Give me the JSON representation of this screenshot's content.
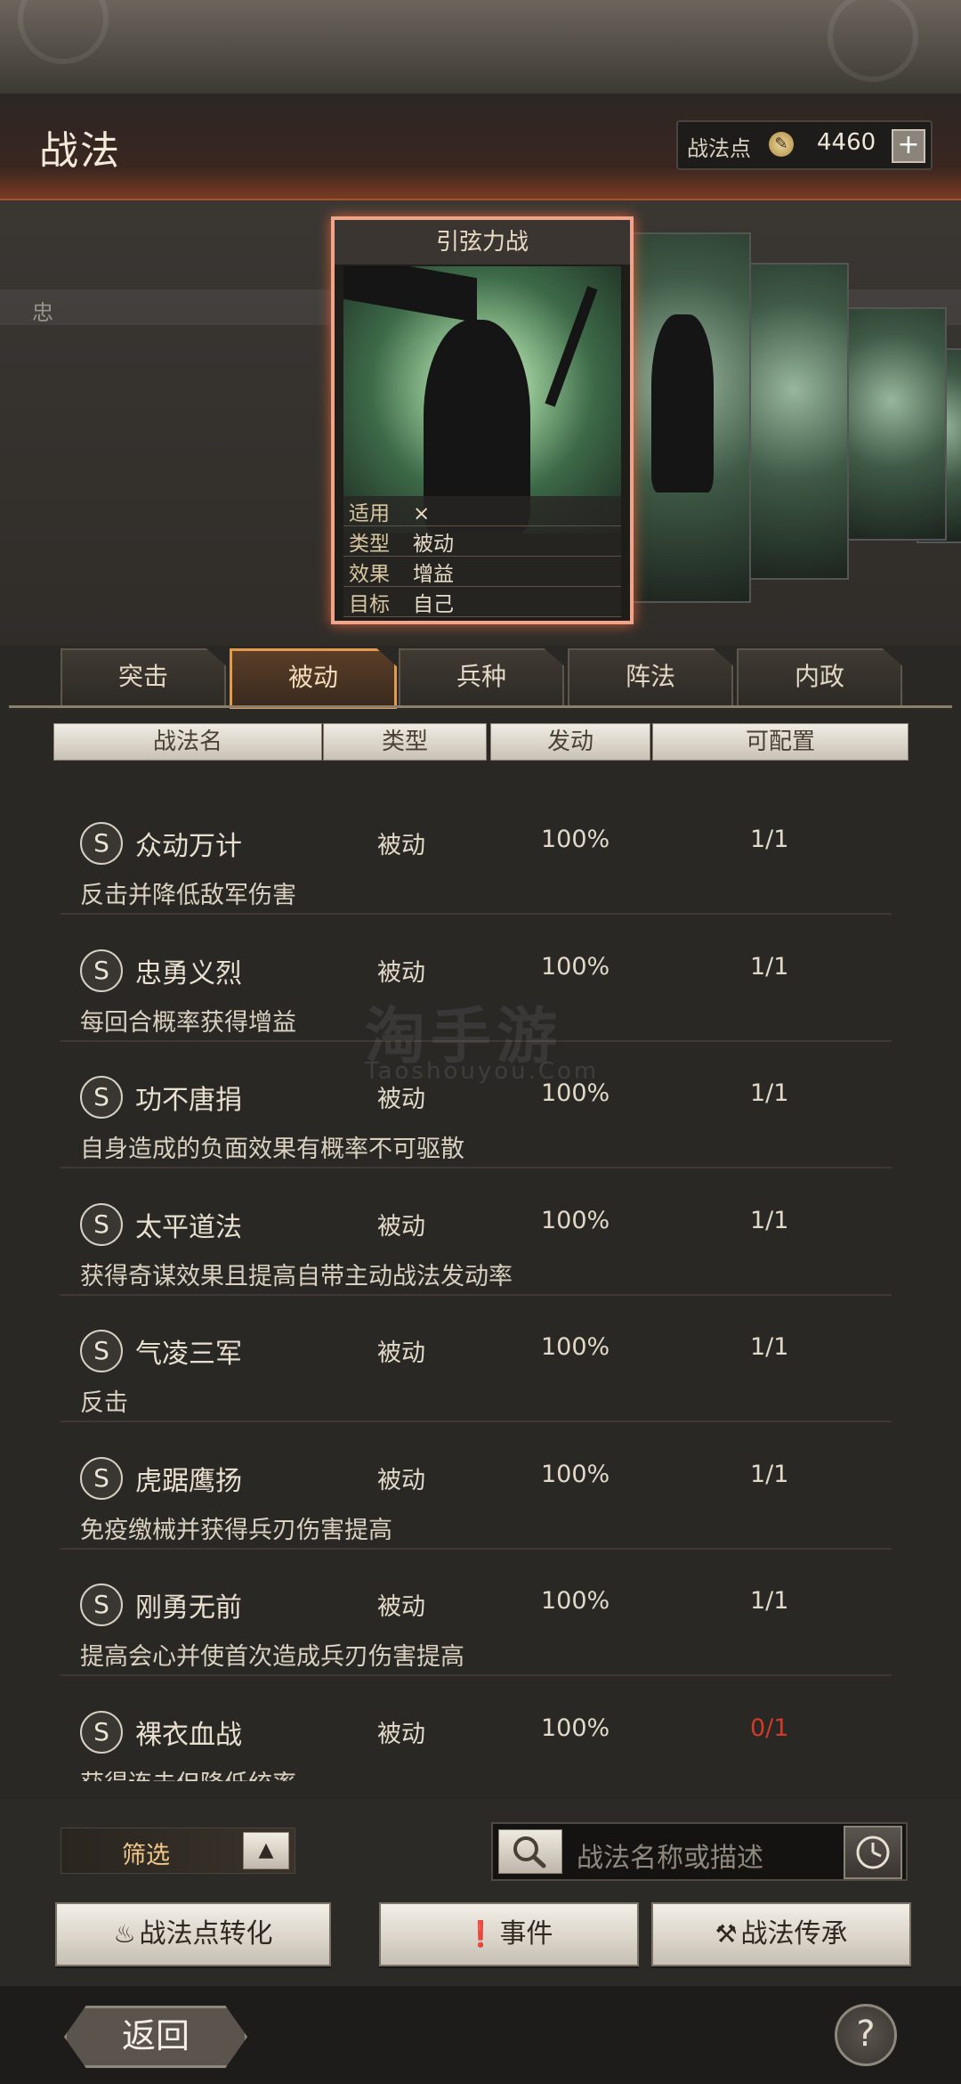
{
  "header": {
    "title": "战法",
    "points_label": "战法点",
    "points_value": "4460",
    "add_symbol": "+"
  },
  "band_char": "忠",
  "featured_card": {
    "name": "引弦力战",
    "attrs": [
      {
        "key": "适用",
        "value": "⨯"
      },
      {
        "key": "类型",
        "value": "被动"
      },
      {
        "key": "效果",
        "value": "增益"
      },
      {
        "key": "目标",
        "value": "自己"
      }
    ]
  },
  "tabs": [
    {
      "label": "突击",
      "active": false
    },
    {
      "label": "被动",
      "active": true
    },
    {
      "label": "兵种",
      "active": false
    },
    {
      "label": "阵法",
      "active": false
    },
    {
      "label": "内政",
      "active": false
    }
  ],
  "columns": [
    "战法名",
    "类型",
    "发动",
    "可配置"
  ],
  "rows": [
    {
      "grade": "S",
      "name": "众动万计",
      "type": "被动",
      "rate": "100%",
      "config": "1/1",
      "desc": "反击并降低敌军伤害"
    },
    {
      "grade": "S",
      "name": "忠勇义烈",
      "type": "被动",
      "rate": "100%",
      "config": "1/1",
      "desc": "每回合概率获得增益"
    },
    {
      "grade": "S",
      "name": "功不唐捐",
      "type": "被动",
      "rate": "100%",
      "config": "1/1",
      "desc": "自身造成的负面效果有概率不可驱散"
    },
    {
      "grade": "S",
      "name": "太平道法",
      "type": "被动",
      "rate": "100%",
      "config": "1/1",
      "desc": "获得奇谋效果且提高自带主动战法发动率"
    },
    {
      "grade": "S",
      "name": "气凌三军",
      "type": "被动",
      "rate": "100%",
      "config": "1/1",
      "desc": "反击"
    },
    {
      "grade": "S",
      "name": "虎踞鹰扬",
      "type": "被动",
      "rate": "100%",
      "config": "1/1",
      "desc": "免疫缴械并获得兵刃伤害提高"
    },
    {
      "grade": "S",
      "name": "刚勇无前",
      "type": "被动",
      "rate": "100%",
      "config": "1/1",
      "desc": "提高会心并使首次造成兵刃伤害提高"
    },
    {
      "grade": "S",
      "name": "裸衣血战",
      "type": "被动",
      "rate": "100%",
      "config": "0/1",
      "desc": "获得连击但降低统率"
    }
  ],
  "filter": {
    "label": "筛选",
    "arrow": "▲"
  },
  "search": {
    "placeholder": "战法名称或描述"
  },
  "actions": {
    "convert": "战法点转化",
    "events": "事件",
    "inherit": "战法传承"
  },
  "footer": {
    "back": "返回",
    "help": "?"
  },
  "watermark": {
    "main": "淘手游",
    "sub": "Taoshouyou.Com"
  },
  "colors": {
    "accent": "#e29a4e",
    "card_glow": "#f0a58a",
    "unavailable": "#d23a2a"
  }
}
